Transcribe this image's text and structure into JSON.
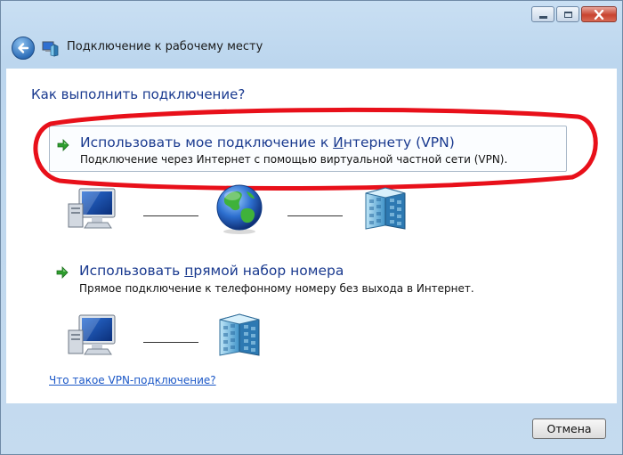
{
  "window": {
    "title": "Подключение к рабочему месту",
    "caption_buttons": [
      "minimize-icon",
      "maximize-icon",
      "close-icon"
    ],
    "back_icon": "back-arrow-icon"
  },
  "main": {
    "question": "Как выполнить подключение?",
    "options": [
      {
        "title_before": "Использовать мое подключение к ",
        "title_access": "И",
        "title_after": "нтернету (VPN)",
        "description": "Подключение через Интернет с помощью виртуальной частной сети (VPN).",
        "diagram": [
          "computer-icon",
          "globe-icon",
          "server-icon"
        ],
        "highlighted": true
      },
      {
        "title_before": "Использовать ",
        "title_access": "п",
        "title_after": "рямой набор номера",
        "description": "Прямое подключение к телефонному номеру без выхода в Интернет.",
        "diagram": [
          "computer-icon",
          "server-icon"
        ]
      }
    ],
    "help_link": "Что такое VPN-подключение?"
  },
  "footer": {
    "cancel_label": "Отмена"
  },
  "colors": {
    "heading_blue": "#1a3a8f",
    "link_blue": "#1c58c7",
    "annotation_red": "#e8101a",
    "arrow_green": "#2e9e2e"
  }
}
